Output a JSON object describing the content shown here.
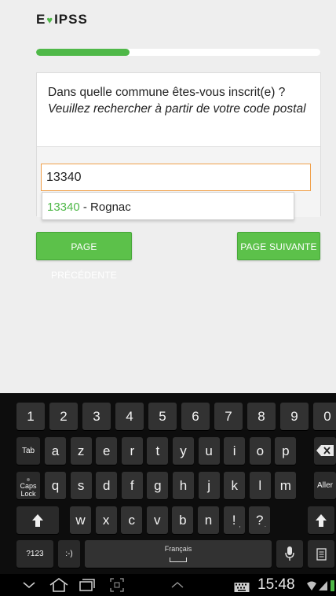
{
  "brand": {
    "prefix": "E",
    "heart": "♥",
    "suffix": "IPSS",
    "accent": "#4fb848"
  },
  "progress": {
    "value": 0.33
  },
  "question": {
    "text": "Dans quelle commune êtes-vous inscrit(e) ?",
    "hint": "Veuillez rechercher à partir de votre code postal"
  },
  "search": {
    "value": "13340",
    "placeholder": ""
  },
  "suggestion": {
    "zip": "13340",
    "rest": " - Rognac"
  },
  "buttons": {
    "prev": "PAGE PRÉCÉDENTE",
    "next": "PAGE SUIVANTE"
  },
  "keyboard": {
    "row1": [
      "1",
      "2",
      "3",
      "4",
      "5",
      "6",
      "7",
      "8",
      "9",
      "0"
    ],
    "row2": [
      "Tab",
      "a",
      "z",
      "e",
      "r",
      "t",
      "y",
      "u",
      "i",
      "o",
      "p"
    ],
    "row3": [
      "Caps Lock",
      "q",
      "s",
      "d",
      "f",
      "g",
      "h",
      "j",
      "k",
      "l",
      "m",
      "Aller"
    ],
    "row4": [
      "w",
      "x",
      "c",
      "v",
      "b",
      "n",
      "!",
      "?"
    ],
    "row4_subs": [
      ",",
      "."
    ],
    "row5": {
      "sym": "?123",
      "emoji": ":-)",
      "space_label": "Français"
    }
  },
  "status": {
    "time": "15:48"
  }
}
